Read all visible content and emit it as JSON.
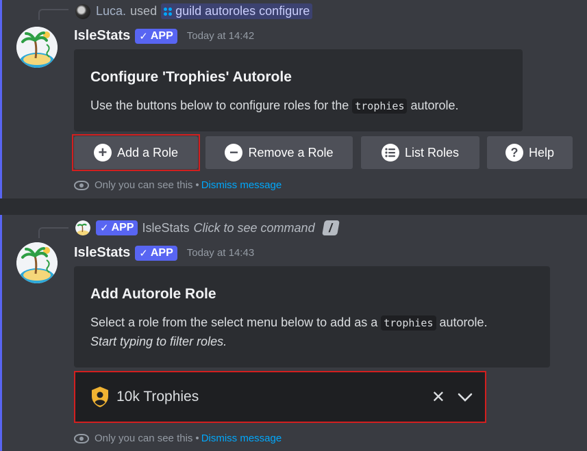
{
  "message1": {
    "reply": {
      "user": "Luca.",
      "used_text": "used",
      "command": "guild autoroles configure"
    },
    "author": "IsleStats",
    "badge": "APP",
    "timestamp": "Today at 14:42",
    "embed": {
      "title": "Configure 'Trophies' Autorole",
      "desc_before": "Use the buttons below to configure roles for the",
      "desc_code": "trophies",
      "desc_after": "autorole."
    },
    "buttons": [
      {
        "label": "Add a Role",
        "icon": "plus-circle-icon"
      },
      {
        "label": "Remove a Role",
        "icon": "minus-circle-icon"
      },
      {
        "label": "List Roles",
        "icon": "list-icon"
      },
      {
        "label": "Help",
        "icon": "question-icon"
      }
    ],
    "ephemeral": {
      "text": "Only you can see this",
      "separator": "•",
      "dismiss": "Dismiss message"
    }
  },
  "message2": {
    "reply": {
      "badge": "APP",
      "author": "IsleStats",
      "action": "Click to see command"
    },
    "author": "IsleStats",
    "badge": "APP",
    "timestamp": "Today at 14:43",
    "embed": {
      "title": "Add Autorole Role",
      "desc_before": "Select a role from the select menu below to add as a",
      "desc_code": "trophies",
      "desc_after": "autorole.",
      "desc_italic": "Start typing to filter roles."
    },
    "select": {
      "value": "10k Trophies",
      "icon": "shield-user-icon"
    },
    "ephemeral": {
      "text": "Only you can see this",
      "separator": "•",
      "dismiss": "Dismiss message"
    }
  },
  "colors": {
    "accent": "#5865f2",
    "link": "#00a8fc",
    "highlight": "#d31f1f",
    "role": "#f0b232"
  }
}
